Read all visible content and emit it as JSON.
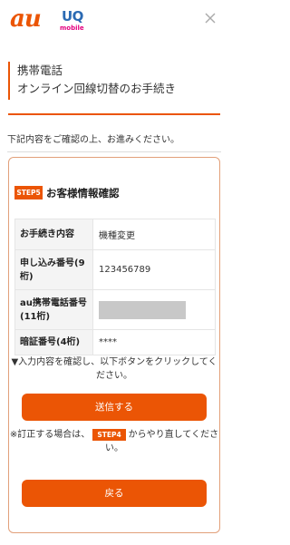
{
  "header": {
    "au_logo": "au",
    "uq_logo": "UQ",
    "uq_sub": "mobile",
    "close_icon": "close-icon"
  },
  "title": {
    "line1": "携帯電話",
    "line2": "オンライン回線切替のお手続き"
  },
  "intro": "下記内容をご確認の上、お進みください。",
  "step": {
    "badge": "STEP5",
    "title": "お客様情報確認"
  },
  "table": {
    "rows": [
      {
        "label": "お手続き内容",
        "value": "機種変更"
      },
      {
        "label": "申し込み番号(9桁)",
        "value": "123456789"
      },
      {
        "label": "au携帯電話番号(11桁)",
        "value": ""
      },
      {
        "label": "暗証番号(4桁)",
        "value": "****"
      }
    ]
  },
  "confirm_note": "▼入力内容を確認し、以下ボタンをクリックしてください。",
  "send_label": "送信する",
  "correction": {
    "prefix": "※訂正する場合は、",
    "badge": "STEP4",
    "suffix": "からやり直してください。"
  },
  "back_label": "戻る",
  "colors": {
    "accent": "#eb5505",
    "uq_blue": "#2b6ab3",
    "uq_pink": "#e4007f"
  }
}
